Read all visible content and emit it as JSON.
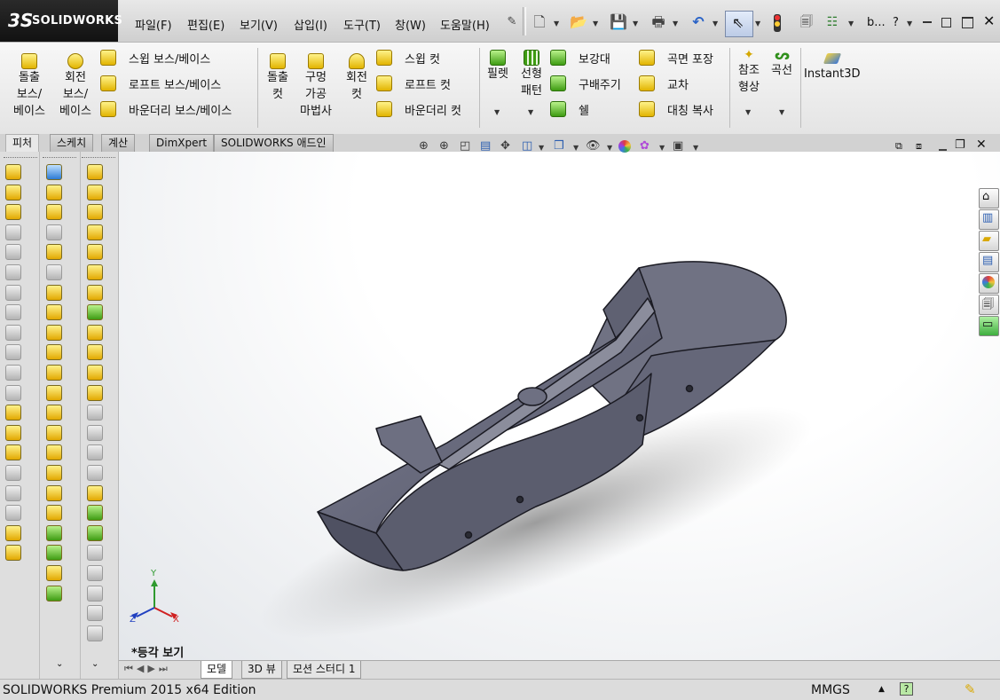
{
  "app": {
    "logo_mark": "3S",
    "logo_text": "SOLIDWORKS"
  },
  "menu": [
    "파일(F)",
    "편집(E)",
    "보기(V)",
    "삽입(I)",
    "도구(T)",
    "창(W)",
    "도움말(H)"
  ],
  "title_short": "b...",
  "help_glyph": "?",
  "ribbon": {
    "extrude": "돌출\n보스/\n베이스",
    "revolve": "회전\n보스/\n베이스",
    "swept_boss": "스윕 보스/베이스",
    "loft_boss": "로프트 보스/베이스",
    "boundary_boss": "바운더리 보스/베이스",
    "extrude_cut": "돌출\n컷",
    "hole_wizard": "구멍\n가공\n마법사",
    "revolve_cut": "회전\n컷",
    "swept_cut": "스윕 컷",
    "loft_cut": "로프트 컷",
    "boundary_cut": "바운더리 컷",
    "fillet": "필렛",
    "linear_pattern": "선형\n패턴",
    "rib": "보강대",
    "draft": "구배주기",
    "shell": "쉘",
    "wrap": "곡면 포장",
    "intersect": "교차",
    "mirror": "대칭 복사",
    "reference_geometry": "참조\n형상",
    "curves": "곡선",
    "instant3d": "Instant3D"
  },
  "cm_tabs": [
    "피처",
    "스케치",
    "계산",
    "DimXpert",
    "SOLIDWORKS 애드인"
  ],
  "view": {
    "orientation_label": "*등각 보기",
    "triad": {
      "x": "X",
      "y": "Y",
      "z": "Z"
    }
  },
  "bottom_tabs": [
    "모델",
    "3D 뷰",
    "모션 스터디 1"
  ],
  "status": {
    "left": "SOLIDWORKS Premium 2015 x64 Edition",
    "units": "MMGS"
  },
  "colors": {
    "accent_yellow": "#f2c200",
    "model_gray": "#6c6e80",
    "logo_bg": "#1a1a1a"
  }
}
